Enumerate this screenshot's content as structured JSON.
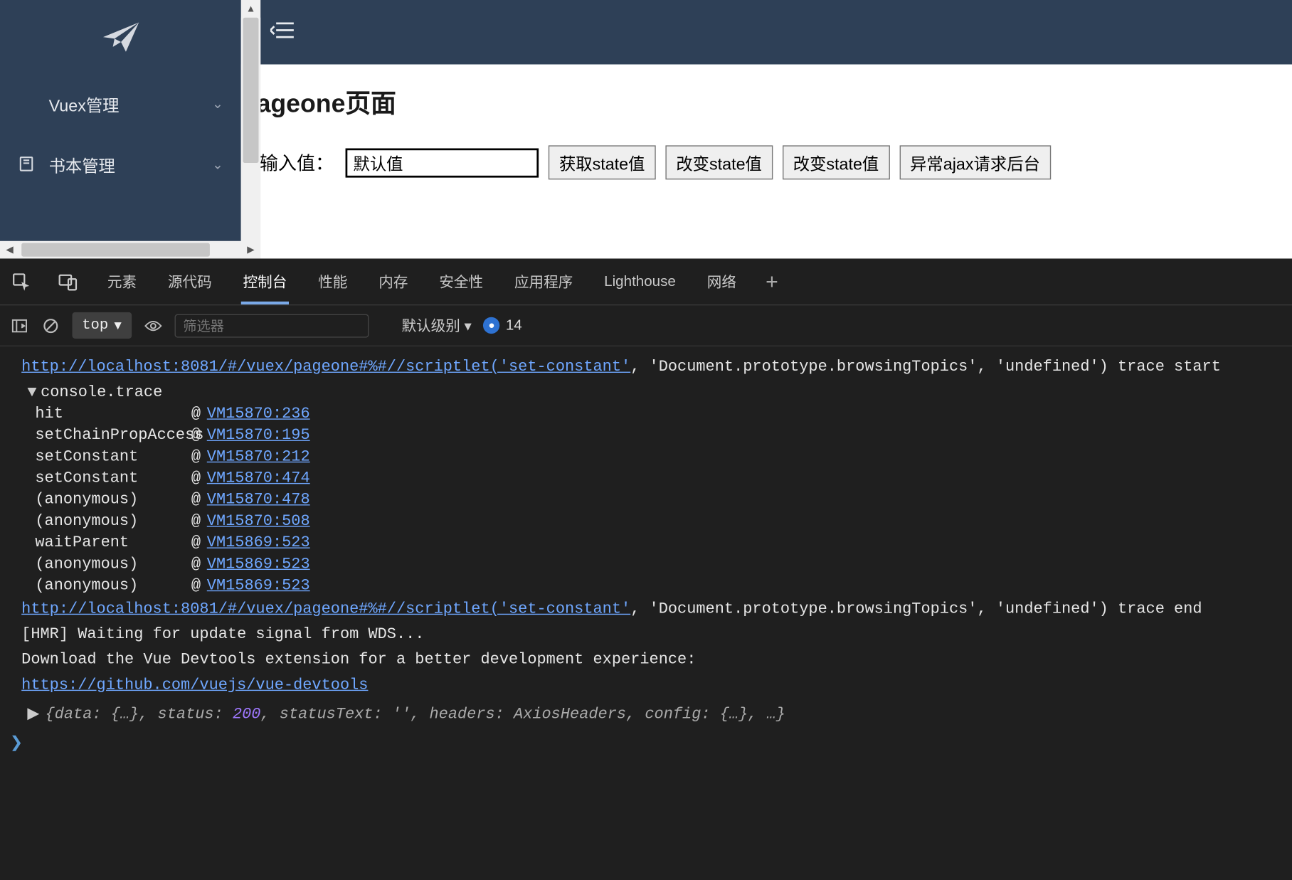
{
  "sidebar": {
    "items": [
      {
        "label": "Vuex管理",
        "icon": ""
      },
      {
        "label": "书本管理",
        "icon": "book"
      }
    ]
  },
  "page": {
    "title": "pageone页面",
    "input_label": "请输入值：",
    "input_value": "默认值",
    "buttons": [
      "获取state值",
      "改变state值",
      "改变state值",
      "异常ajax请求后台"
    ]
  },
  "devtools": {
    "tabs": [
      "元素",
      "源代码",
      "控制台",
      "性能",
      "内存",
      "安全性",
      "应用程序",
      "Lighthouse",
      "网络"
    ],
    "active_tab": "控制台",
    "toolbar": {
      "context": "top",
      "filter_placeholder": "筛选器",
      "level": "默认级别",
      "badge_count": "14"
    },
    "console": {
      "url": "http://localhost:8081/#/vuex/pageone#%#//scriptlet('set-constant'",
      "url_tail_start": ", 'Document.prototype.browsingTopics', 'undefined') trace start",
      "url_tail_end": ", 'Document.prototype.browsingTopics', 'undefined') trace end",
      "trace_label": "console.trace",
      "trace": [
        {
          "fn": "hit",
          "loc": "VM15870:236"
        },
        {
          "fn": "setChainPropAccess",
          "loc": "VM15870:195"
        },
        {
          "fn": "setConstant",
          "loc": "VM15870:212"
        },
        {
          "fn": "setConstant",
          "loc": "VM15870:474"
        },
        {
          "fn": "(anonymous)",
          "loc": "VM15870:478"
        },
        {
          "fn": "(anonymous)",
          "loc": "VM15870:508"
        },
        {
          "fn": "waitParent",
          "loc": "VM15869:523"
        },
        {
          "fn": "(anonymous)",
          "loc": "VM15869:523"
        },
        {
          "fn": "(anonymous)",
          "loc": "VM15869:523"
        }
      ],
      "hmr": "[HMR] Waiting for update signal from WDS...",
      "vue_line": "Download the Vue Devtools extension for a better development experience:",
      "vue_link": "https://github.com/vuejs/vue-devtools",
      "obj_preview": {
        "text_prefix": "{data: {…}, status: ",
        "status": "200",
        "text_suffix": ", statusText: '', headers: AxiosHeaders, config: {…}, …}"
      }
    }
  }
}
